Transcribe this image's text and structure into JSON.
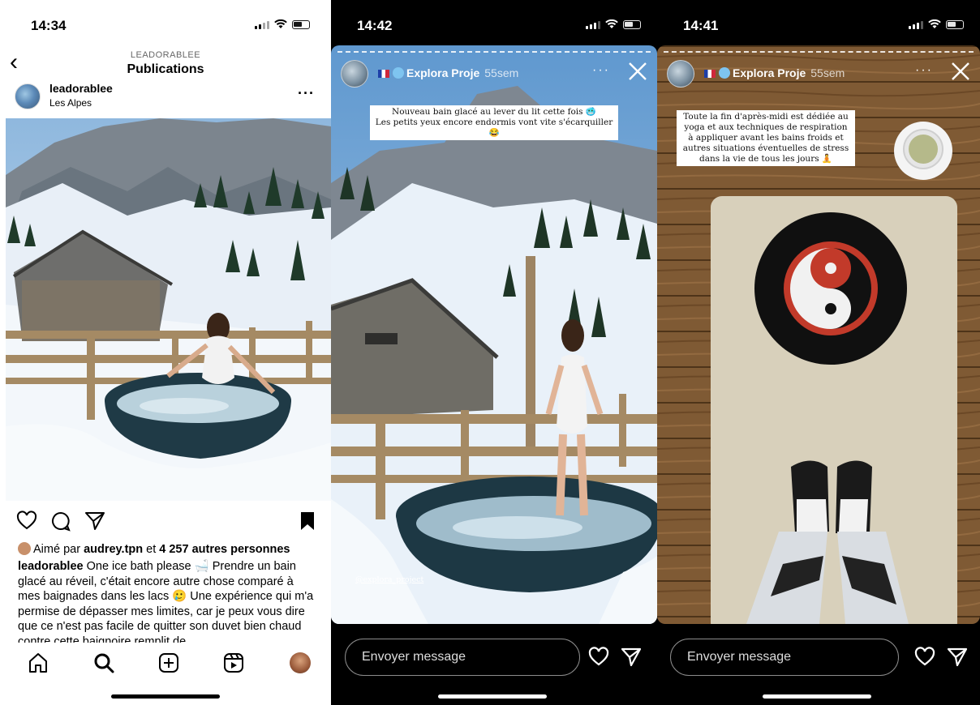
{
  "post_screen": {
    "status_time": "14:34",
    "header_username": "LEADORABLEE",
    "header_title": "Publications",
    "post_username": "leadorablee",
    "post_location": "Les Alpes",
    "more": "···",
    "likes_prefix": "Aimé par ",
    "likes_user": "audrey.tpn",
    "likes_mid": " et ",
    "likes_count": "4 257 autres personnes",
    "caption_user": "leadorablee",
    "caption_text": " One ice bath please 🛁 Prendre un bain glacé au réveil, c'était encore autre chose comparé à mes baignades dans les lacs 🥲 Une expérience qui m'a permise de dépasser mes limites, car je peux vous dire que ce n'est pas facile de quitter son duvet bien chaud contre cette baignoire remplit de"
  },
  "story_1": {
    "status_time": "14:42",
    "account": "Explora Proje",
    "age": "55sem",
    "more": "···",
    "caption_line1": "Nouveau bain glacé au lever du lit cette fois 🥶",
    "caption_line2": "Les petits yeux encore endormis vont vite s'écarquiller 😂",
    "mention": "@explora_project",
    "reply_placeholder": "Envoyer message"
  },
  "story_2": {
    "status_time": "14:41",
    "account": "Explora Proje",
    "age": "55sem",
    "more": "···",
    "caption": "Toute la fin d'après-midi est dédiée au yoga et aux techniques de respiration à appliquer avant les bains froids et autres situations éventuelles de stress dans la vie de tous les jours 🧘",
    "reply_placeholder": "Envoyer message"
  },
  "colors": {
    "sky": "#9cc3e6",
    "rock": "#7d8690",
    "snow": "#eef4fa",
    "wood": "#8b6a45",
    "tub": "#1f3a46",
    "floor": "#7a5530",
    "mat": "#d9d1bd"
  }
}
